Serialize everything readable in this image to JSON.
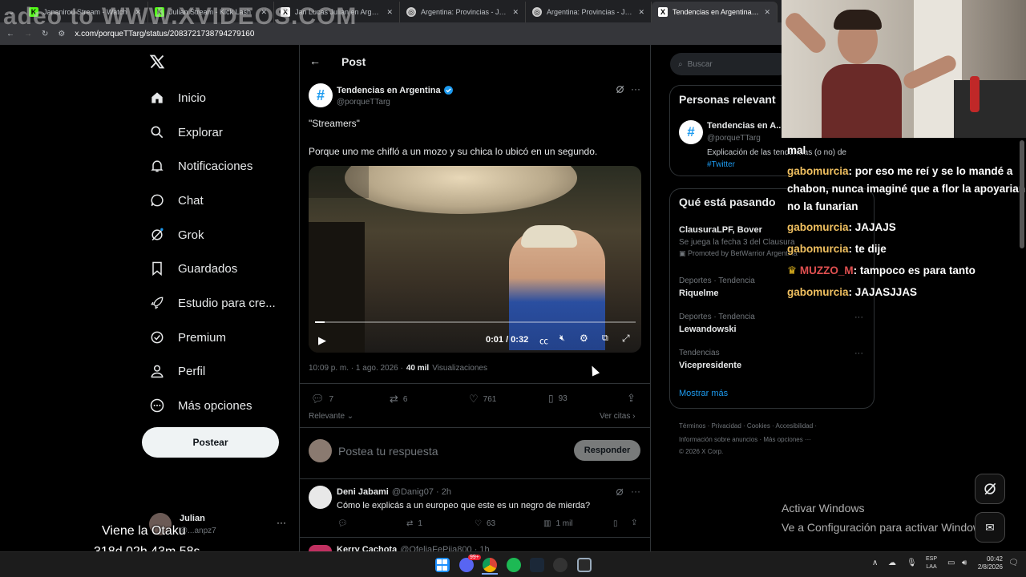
{
  "browser": {
    "tabs": [
      {
        "title": "Jananirou Stream - Watch",
        "icon": "K",
        "color": "#53fc18"
      },
      {
        "title": "Julian Stream - Kick Lash",
        "icon": "K",
        "color": "#53fc18"
      },
      {
        "title": "Jan Lucas Julian en Argentina",
        "icon": "X",
        "color": "#ffffff"
      },
      {
        "title": "Argentina: Provincias - Juego de",
        "icon": "◎",
        "color": "#e8e8e8"
      },
      {
        "title": "Argentina: Provincias - Juego de",
        "icon": "◎",
        "color": "#e8e8e8"
      },
      {
        "title": "Tendencias en Argentina en X:",
        "icon": "X",
        "color": "#ffffff"
      }
    ],
    "url": "x.com/porqueTTarg/status/2083721738794279160",
    "watermark": "adeo to WWW.XVIDEOS.COM"
  },
  "sidebar": {
    "items": [
      {
        "label": "Inicio",
        "icon": "home-icon"
      },
      {
        "label": "Explorar",
        "icon": "search-icon"
      },
      {
        "label": "Notificaciones",
        "icon": "bell-icon"
      },
      {
        "label": "Chat",
        "icon": "chat-icon"
      },
      {
        "label": "Grok",
        "icon": "grok-icon"
      },
      {
        "label": "Guardados",
        "icon": "bookmark-icon"
      },
      {
        "label": "Estudio para cre...",
        "icon": "rocket-icon"
      },
      {
        "label": "Premium",
        "icon": "verified-icon"
      },
      {
        "label": "Perfil",
        "icon": "person-icon"
      },
      {
        "label": "Más opciones",
        "icon": "more-circle-icon"
      }
    ],
    "post_button": "Postear",
    "account_name": "Julian",
    "account_handle": "@...anpz7"
  },
  "post": {
    "header": "Post",
    "author": "Tendencias en Argentina",
    "handle": "@porqueTTarg",
    "line1": "\"Streamers\"",
    "line2": "Porque uno me chifló a un mozo y su chica lo ubicó en un segundo.",
    "video_time": "0:01 / 0:32",
    "video_progress": 0.03,
    "timestamp": "10:09 p. m. · 1 ago. 2026 ·",
    "views": "40 mil",
    "views_label": "Visualizaciones",
    "replies": "7",
    "reposts": "6",
    "likes": "761",
    "bookmarks": "93",
    "sort": "Relevante",
    "quotes": "Ver citas",
    "reply_placeholder": "Postea tu respuesta",
    "reply_button": "Responder"
  },
  "replies": [
    {
      "name": "Deni Jabami",
      "handle": "@Danig07 · 2h",
      "text": "Cómo le explicás a un europeo que este es un negro de mierda?",
      "reposts": "1",
      "likes": "63",
      "views": "1 mil"
    },
    {
      "name": "Kerry Cachota",
      "handle": "@OfeliaFePiia800 · 1h"
    }
  ],
  "right": {
    "search_placeholder": "Buscar",
    "relevant_title": "Personas relevant",
    "rel_name": "Tendencias en A...",
    "rel_handle": "@porqueTTarg",
    "rel_bio": "Explicación de las tendencias (o no) de",
    "rel_tag": "#Twitter",
    "happening_title": "Qué está pasando",
    "trends": [
      {
        "cat": "",
        "name": "ClausuraLPF, Bover",
        "sub": "Se juega la fecha 3 del Clausura",
        "promo": "Promoted by BetWarrior Argentina"
      },
      {
        "cat": "Deportes · Tendencia",
        "name": "Riquelme"
      },
      {
        "cat": "Deportes · Tendencia",
        "name": "Lewandowski"
      },
      {
        "cat": "Tendencias",
        "name": "Vicepresidente"
      }
    ],
    "show_more": "Mostrar más",
    "footer1": "Términos · Privacidad · Cookies · Accesibilidad ·",
    "footer2": "Información sobre anuncios · Más opciones ···",
    "footer3": "© 2026 X Corp."
  },
  "chat": [
    {
      "user": "",
      "msg": "mal"
    },
    {
      "user": "gabomurcia",
      "msg": ": por eso me reí y se lo mandé a chabon, nunca imaginé que a flor la apoyarian no la funarian"
    },
    {
      "user": "gabomurcia",
      "msg": ": JAJAJS"
    },
    {
      "user": "gabomurcia",
      "msg": ": te dije"
    },
    {
      "user": "MUZZO_M",
      "msg": ": tampoco es para tanto"
    },
    {
      "user": "gabomurcia",
      "msg": ": JAJASJJAS"
    }
  ],
  "overlay": {
    "caption": "Viene la Otaku",
    "countdown": "318d 02h 43m 58s",
    "activate1": "Activar Windows",
    "activate2": "Ve a Configuración para activar Windows"
  },
  "taskbar": {
    "lang1": "ESP",
    "lang2": "LAA",
    "time": "00:42",
    "date": "2/8/2026",
    "discord_badge": "99+"
  },
  "colors": {
    "accent": "#1d9bf0",
    "chat_user": "#f0c060",
    "chat_user_alt": "#e05050"
  }
}
